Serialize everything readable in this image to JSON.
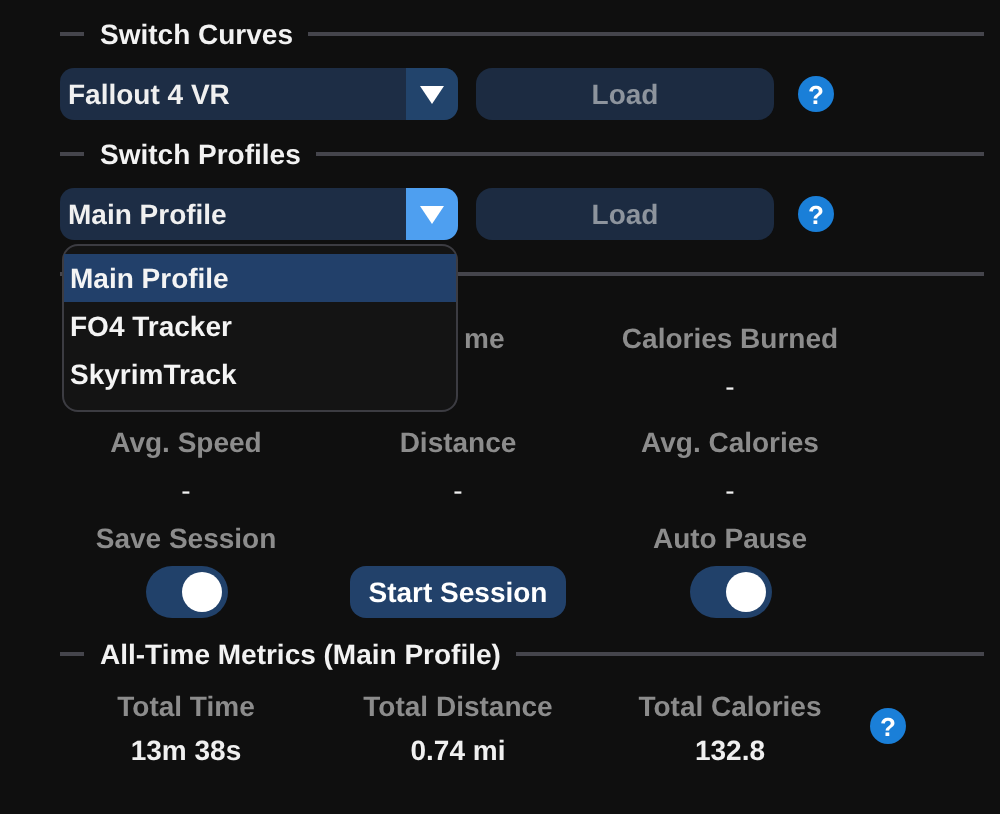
{
  "sections": [
    {
      "kind": "selector",
      "title": "Switch Curves",
      "dropdown": {
        "value": "Fallout 4 VR",
        "expanded": false
      },
      "button": "Load",
      "help": "?"
    },
    {
      "kind": "selector",
      "title": "Switch Profiles",
      "dropdown": {
        "value": "Main Profile",
        "expanded": true,
        "options": [
          {
            "label": "Main Profile",
            "selected": true
          },
          {
            "label": "FO4 Tracker",
            "selected": false
          },
          {
            "label": "SkyrimTrack",
            "selected": false
          }
        ]
      },
      "button": "Load",
      "help": "?"
    },
    {
      "kind": "session",
      "metrics": [
        {
          "kind": "partial",
          "label": "me"
        },
        {
          "kind": "metric",
          "label": "Calories Burned",
          "value": "-"
        },
        {
          "kind": "metric",
          "label": "Avg. Speed",
          "value": "-"
        },
        {
          "kind": "metric",
          "label": "Distance",
          "value": "-"
        },
        {
          "kind": "metric",
          "label": "Avg. Calories",
          "value": "-"
        }
      ],
      "controls": [
        {
          "kind": "toggle",
          "label": "Save Session",
          "on": true
        },
        {
          "kind": "button",
          "label": "Start Session"
        },
        {
          "kind": "toggle",
          "label": "Auto Pause",
          "on": true
        }
      ]
    },
    {
      "kind": "totals",
      "title": "All-Time Metrics (Main Profile)",
      "metrics": [
        {
          "label": "Total Time",
          "value": "13m 38s"
        },
        {
          "label": "Total Distance",
          "value": "0.74 mi"
        },
        {
          "label": "Total Calories",
          "value": "132.8"
        }
      ],
      "help": "?"
    }
  ]
}
